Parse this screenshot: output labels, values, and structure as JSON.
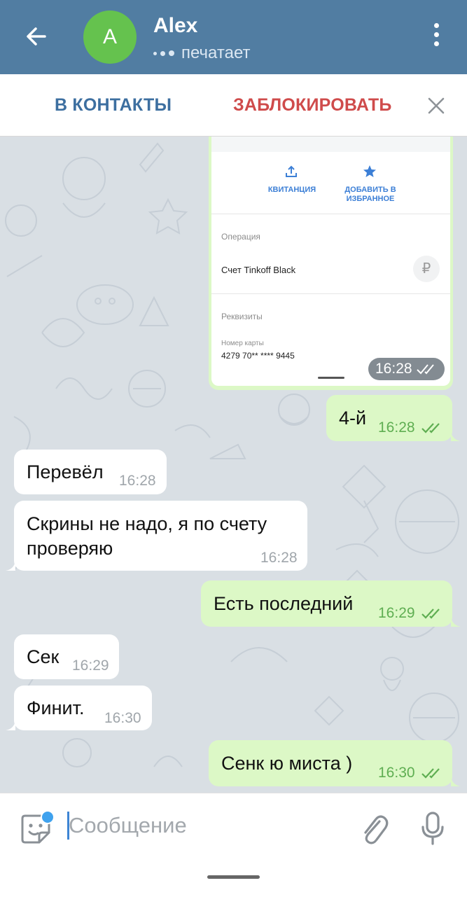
{
  "header": {
    "avatar_letter": "A",
    "contact_name": "Alex",
    "status": "печатает"
  },
  "action_bar": {
    "add_contact": "В КОНТАКТЫ",
    "block": "ЗАБЛОКИРОВАТЬ"
  },
  "receipt_image": {
    "actions": [
      {
        "label": "КВИТАНЦИЯ",
        "icon": "upload-icon"
      },
      {
        "label": "ДОБАВИТЬ В ИЗБРАННОЕ",
        "icon": "star-icon"
      }
    ],
    "operation_label": "Операция",
    "operation_value": "Счет Tinkoff Black",
    "currency_symbol": "₽",
    "details_label": "Реквизиты",
    "card_label": "Номер карты",
    "card_value": "4279 70** **** 9445",
    "time": "16:28"
  },
  "messages": [
    {
      "direction": "out",
      "text": "4-й",
      "time": "16:28",
      "read": true
    },
    {
      "direction": "in",
      "text": "Перевёл",
      "time": "16:28"
    },
    {
      "direction": "in",
      "text_line1": "Скрины не надо, я по счету",
      "text_line2": "проверяю",
      "time": "16:28"
    },
    {
      "direction": "out",
      "text": "Есть последний",
      "time": "16:29",
      "read": true
    },
    {
      "direction": "in",
      "text": "Сек",
      "time": "16:29"
    },
    {
      "direction": "in",
      "text": "Финит.",
      "time": "16:30"
    },
    {
      "direction": "out",
      "text": "Сенк ю миста )",
      "time": "16:30",
      "read": true
    }
  ],
  "composer": {
    "placeholder": "Сообщение"
  },
  "colors": {
    "header_bg": "#517da2",
    "outgoing_bubble": "#dcf8c6",
    "incoming_bubble": "#ffffff",
    "chat_bg": "#d9dfe4",
    "accent_blue": "#3d6fa0",
    "block_red": "#cf4b4b",
    "read_check": "#5fae52"
  }
}
